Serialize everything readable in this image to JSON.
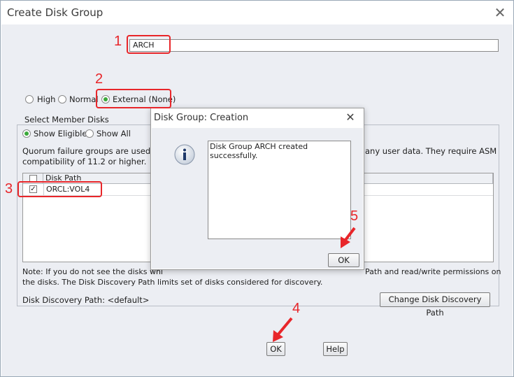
{
  "window": {
    "title": "Create Disk Group",
    "close_icon": "close-icon"
  },
  "disk_group_name": {
    "value": "ARCH"
  },
  "redundancy": {
    "options": [
      "High",
      "Normal",
      "External (None)"
    ],
    "selected": "External (None)"
  },
  "member_disks": {
    "legend": "Select Member Disks",
    "filter_options": [
      "Show Eligible",
      "Show All"
    ],
    "filter_selected": "Show Eligible",
    "quorum_text_line1": "Quorum failure groups are used to",
    "quorum_text_line1_tail": "any user data. They require ASM",
    "quorum_text_line2": "compatibility of 11.2 or higher.",
    "table": {
      "columns": [
        "",
        "Disk Path"
      ],
      "rows": [
        {
          "checked": true,
          "path": "ORCL:VOL4"
        }
      ]
    }
  },
  "note": {
    "line1_start": "Note: If you do not see the disks whi",
    "line1_end": "Path and read/write permissions on",
    "line2": "the disks. The Disk Discovery Path limits set of disks considered for discovery."
  },
  "discovery": {
    "label": "Disk Discovery Path: <default>",
    "button": "Change Disk Discovery Path"
  },
  "buttons": {
    "ok": "OK",
    "help": "Help"
  },
  "popup": {
    "title": "Disk Group: Creation",
    "icon": "info-icon",
    "message_line1": "Disk Group ARCH created",
    "message_line2": "successfully.",
    "ok": "OK"
  },
  "annotations": [
    "1",
    "2",
    "3",
    "4",
    "5"
  ],
  "colors": {
    "annotation_red": "#e8262a",
    "radio_selected": "#3aa83a",
    "background": "#eceef3"
  }
}
